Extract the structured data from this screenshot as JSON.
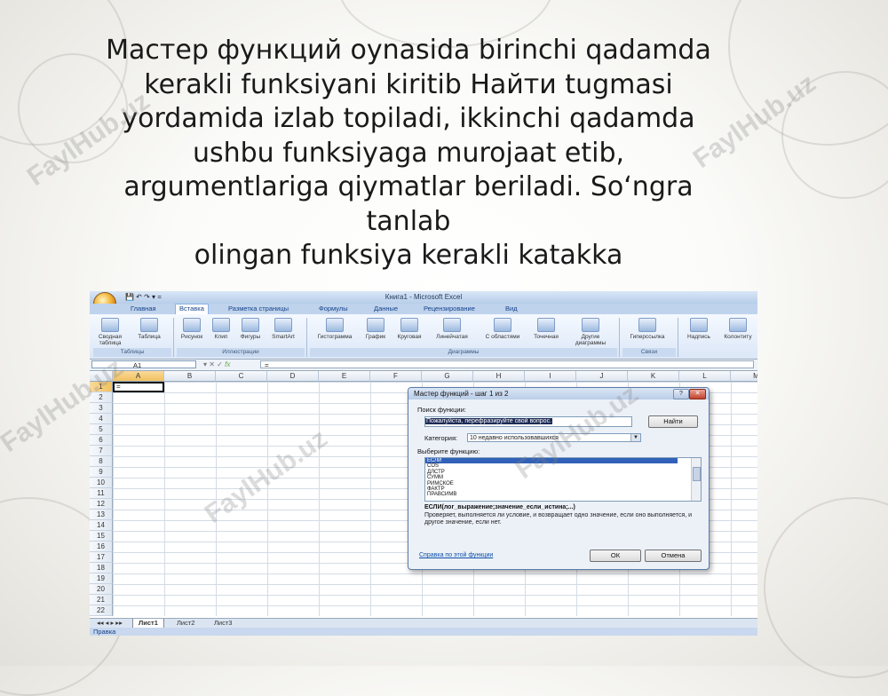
{
  "slide": {
    "title_lines": [
      "Мастер функций oynasida birinchi qadamda",
      "kerakli funksiyani kiritib Найти tugmasi",
      "yordamida izlab topiladi, ikkinchi qadamda",
      "ushbu funksiyaga murojaat etib,",
      "argumentlariga qiymatlar beriladi. So‘ngra",
      "tanlab",
      "olingan funksiya kerakli katakka"
    ],
    "watermark": "FaylHub.uz"
  },
  "excel": {
    "window_title": "Книга1 - Microsoft Excel",
    "qat": "💾 ↶ ↷ ▾  =",
    "tabs": [
      "Главная",
      "Вставка",
      "Разметка страницы",
      "Формулы",
      "Данные",
      "Рецензирование",
      "Вид"
    ],
    "active_tab": "Вставка",
    "ribbon_items": [
      "Сводная таблица",
      "Таблица",
      "Рисунок",
      "Клип",
      "Фигуры",
      "SmartArt",
      "Гистограмма",
      "График",
      "Круговая",
      "Линейчатая",
      "С областями",
      "Точечная",
      "Другие диаграммы",
      "Гиперссылка",
      "Надпись",
      "Колонтиту"
    ],
    "ribbon_groups": [
      "Таблицы",
      "Иллюстрации",
      "Диаграммы",
      "Связи"
    ],
    "name_box": "A1",
    "formula_buttons": "▾  ✕ ✓ ",
    "fx": "fx",
    "formula": "=",
    "columns": [
      "A",
      "B",
      "C",
      "D",
      "E",
      "F",
      "G",
      "H",
      "I",
      "J",
      "K",
      "L",
      "M"
    ],
    "rows": [
      "1",
      "2",
      "3",
      "4",
      "5",
      "6",
      "7",
      "8",
      "9",
      "10",
      "11",
      "12",
      "13",
      "14",
      "15",
      "16",
      "17",
      "18",
      "19",
      "20",
      "21",
      "22"
    ],
    "cell_a1": "=",
    "sheet_nav": "◂◂ ◂ ▸ ▸▸",
    "sheets": [
      "Лист1",
      "Лист2",
      "Лист3"
    ],
    "status": "Правка"
  },
  "dialog": {
    "title": "Мастер функций - шаг 1 из 2",
    "help": "?",
    "close": "✕",
    "search_label": "Поиск функции:",
    "search_value": "Пожалуйста, перефразируйте свой вопрос.",
    "find_button": "Найти",
    "category_label": "Категория:",
    "category_value": "10 недавно использовавшихся",
    "select_label": "Выберите функцию:",
    "functions": [
      "ЕСЛИ",
      "COS",
      "ДЛСТР",
      "СУММ",
      "РИМСКОЕ",
      "ФАКТР",
      "ПРАВСИМВ"
    ],
    "selected_function": "ЕСЛИ",
    "syntax": "ЕСЛИ(лог_выражение;значение_если_истина;...)",
    "description": "Проверяет, выполняется ли условие, и возвращает одно значение, если оно выполняется, и другое значение, если нет.",
    "help_link": "Справка по этой функции",
    "ok_button": "ОК",
    "cancel_button": "Отмена"
  }
}
